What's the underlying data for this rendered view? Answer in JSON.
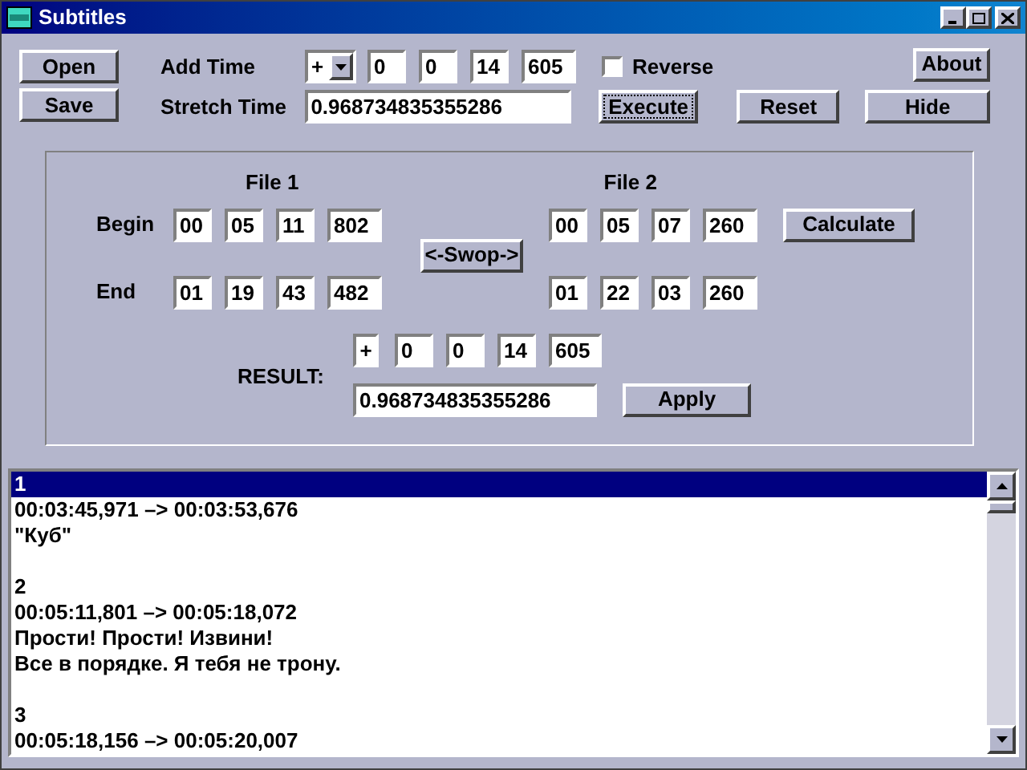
{
  "window": {
    "title": "Subtitles"
  },
  "file_buttons": [
    "Open",
    "Save"
  ],
  "add_time": {
    "label": "Add Time",
    "sign": "+",
    "fields": [
      "0",
      "0",
      "14",
      "605"
    ]
  },
  "reverse": {
    "label": "Reverse",
    "checked": false
  },
  "about_button": "About",
  "stretch_time": {
    "label": "Stretch Time",
    "value": "0.968734835355286"
  },
  "action_buttons": [
    "Execute",
    "Reset",
    "Hide"
  ],
  "sync": {
    "file1_heading": "File 1",
    "file2_heading": "File 2",
    "rows": [
      {
        "label": "Begin",
        "file1": [
          "00",
          "05",
          "11",
          "802"
        ],
        "file2": [
          "00",
          "05",
          "07",
          "260"
        ]
      },
      {
        "label": "End",
        "file1": [
          "01",
          "19",
          "43",
          "482"
        ],
        "file2": [
          "01",
          "22",
          "03",
          "260"
        ]
      }
    ],
    "swop_button": "<-Swop->",
    "calculate_button": "Calculate",
    "result_label": "RESULT:",
    "result_sign": "+",
    "result_fields": [
      "0",
      "0",
      "14",
      "605"
    ],
    "result_stretch": "0.968734835355286",
    "apply_button": "Apply"
  },
  "subtitle_list": [
    {
      "index": "1",
      "time": "00:03:45,971 –> 00:03:53,676",
      "lines": [
        "\"Куб\""
      ],
      "selected": true
    },
    {
      "index": "2",
      "time": "00:05:11,801 –> 00:05:18,072",
      "lines": [
        "Прости! Прости! Извини!",
        "Все в порядке. Я тебя не трону."
      ],
      "selected": false
    },
    {
      "index": "3",
      "time": "00:05:18,156 –> 00:05:20,007",
      "selected": false
    }
  ]
}
